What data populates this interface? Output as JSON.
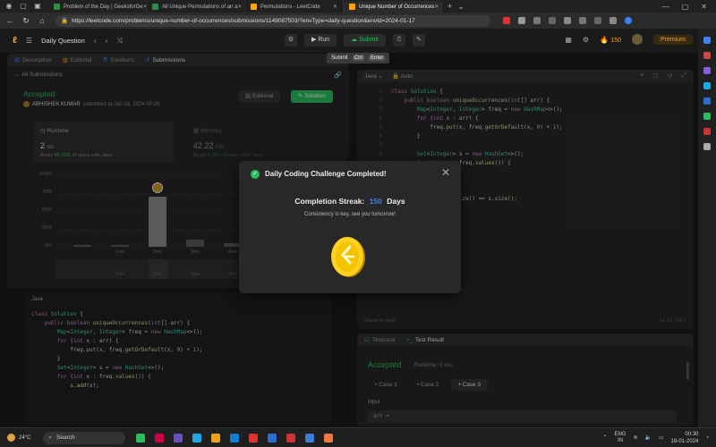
{
  "browser": {
    "tabs": [
      {
        "label": "Problem of the Day | GeeksforGe",
        "color": "#2f8d46",
        "active": false
      },
      {
        "label": "All Unique Permutations of an a",
        "color": "#2f8d46",
        "active": false
      },
      {
        "label": "Permutations - LeetCode",
        "color": "#ffa116",
        "active": false
      },
      {
        "label": "Unique Number of Occurrences",
        "color": "#ffa116",
        "active": true
      }
    ],
    "url": "https://leetcode.com/problems/unique-number-of-occurrences/submissions/1149087503/?envType=daily-question&envId=2024-01-17"
  },
  "header": {
    "title": "Daily Question",
    "run_label": "Run",
    "submit_label": "Submit",
    "streak_count": "150",
    "premium_label": "Premium"
  },
  "tooltip": {
    "label": "Submit",
    "key1": "Ctrl",
    "key2": "Enter"
  },
  "left_panel": {
    "tabs": [
      "Description",
      "Editorial",
      "Solutions",
      "Submissions"
    ],
    "back_label": "All Submissions",
    "status": "Accepted",
    "user": "ABHISHEK KUMAR",
    "submitted_text": "submitted at Jan 18, 2024 00:29",
    "editorial_button": "Editorial",
    "solution_button": "Solution",
    "runtime": {
      "label": "Runtime",
      "value": "2",
      "unit": "ms",
      "beats_prefix": "Beats",
      "beats_pct": "95.10%",
      "beats_suffix": "of users with Java"
    },
    "memory": {
      "label": "Memory",
      "value": "42.22",
      "unit": "MB",
      "beats_prefix": "Beats",
      "beats_pct": "5.38%",
      "beats_suffix": "of users with Java"
    }
  },
  "chart_data": {
    "type": "bar",
    "y_ticks": [
      "100%",
      "75%",
      "50%",
      "25%",
      "0%"
    ],
    "ylim": [
      0,
      100
    ],
    "categories": [
      "",
      "1ms",
      "2ms",
      "3ms",
      "4ms"
    ],
    "values": [
      2,
      3,
      70,
      10,
      5
    ],
    "highlight_index": 2,
    "distribution_labels": [
      "1ms",
      "2ms",
      "3ms",
      "4ms"
    ]
  },
  "left_code": {
    "language": "Java"
  },
  "editor": {
    "language": "Java",
    "mode": "Auto",
    "saved_label": "Saved to local",
    "cursor_pos": "Ln 16, Col 1"
  },
  "code_lines": [
    "class Solution {",
    "    public boolean uniqueOccurrences(int[] arr) {",
    "        Map<Integer, Integer> freq = new HashMap<>();",
    "        for (int x : arr) {",
    "            freq.put(x, freq.getOrDefault(x, 0) + 1);",
    "        }",
    "",
    "        Set<Integer> s = new HashSet<>();",
    "        for (int x : freq.values()) {",
    "            s.add(x);",
    "        }",
    "",
    "        return freq.size() == s.size();"
  ],
  "right_code_visible_tail": "e() == s.size();",
  "testcase": {
    "tab1": "Testcase",
    "tab2": "Test Result",
    "status": "Accepted",
    "runtime": "Runtime: 0 ms",
    "cases": [
      "Case 1",
      "Case 2",
      "Case 3"
    ],
    "input_label": "Input",
    "input_value": "arr ="
  },
  "modal": {
    "title": "Daily Coding Challenge Completed!",
    "streak_prefix": "Completion Streak:",
    "streak_value": "150",
    "streak_suffix": "Days",
    "message": "Consistency is key, see you tomorrow!"
  },
  "taskbar": {
    "weather": "24°C",
    "search_label": "Search",
    "lang_top": "ENG",
    "lang_bottom": "IN",
    "time": "00:30",
    "date": "18-01-2024"
  }
}
